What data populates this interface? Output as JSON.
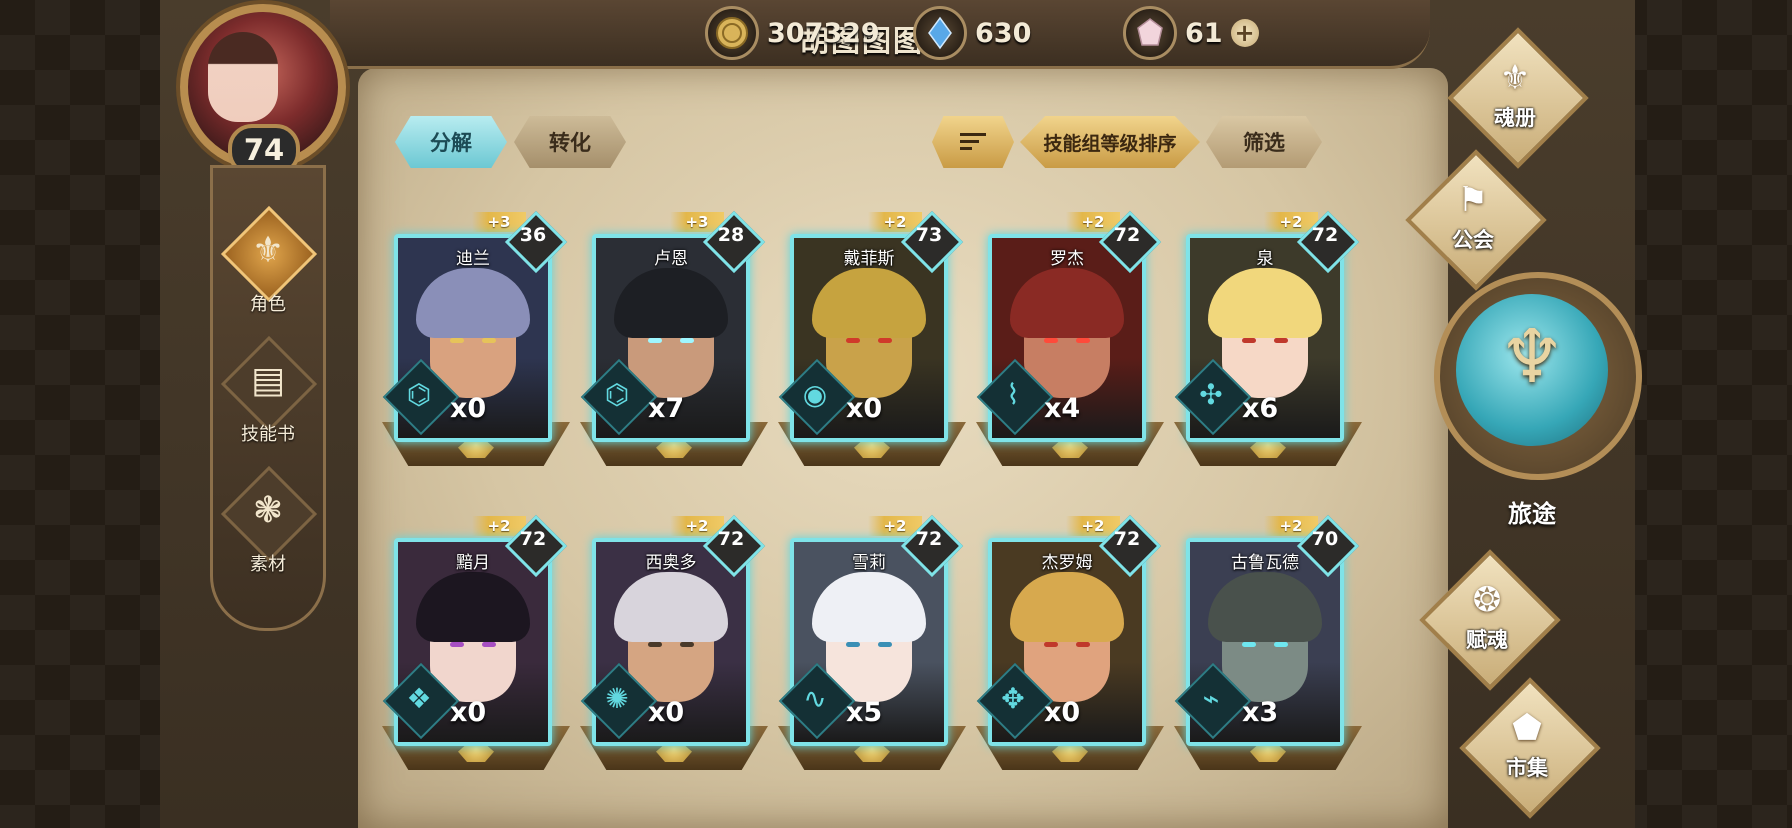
{
  "player": {
    "name": "胡图图图",
    "level": "74"
  },
  "currencies": [
    {
      "icon": "gold-coin-icon",
      "value": "307329"
    },
    {
      "icon": "blue-crystal-icon",
      "value": "630"
    },
    {
      "icon": "pink-gem-icon",
      "value": "61"
    }
  ],
  "left_nav": [
    {
      "label": "角色",
      "icon": "helmet-icon",
      "active": true
    },
    {
      "label": "技能书",
      "icon": "skill-book-icon",
      "active": false
    },
    {
      "label": "素材",
      "icon": "beast-material-icon",
      "active": false
    }
  ],
  "tabs": {
    "decompose": "分解",
    "convert": "转化"
  },
  "toolbar": {
    "sort_order_icon": "sort-lines-icon",
    "sort_label": "技能组等级排序",
    "filter_label": "筛选"
  },
  "heroes": [
    {
      "name": "迪兰",
      "bonus": "+3",
      "level": "36",
      "count": "x0"
    },
    {
      "name": "卢恩",
      "bonus": "+3",
      "level": "28",
      "count": "x7"
    },
    {
      "name": "戴菲斯",
      "bonus": "+2",
      "level": "73",
      "count": "x0"
    },
    {
      "name": "罗杰",
      "bonus": "+2",
      "level": "72",
      "count": "x4"
    },
    {
      "name": "泉",
      "bonus": "+2",
      "level": "72",
      "count": "x6"
    },
    {
      "name": "黯月",
      "bonus": "+2",
      "level": "72",
      "count": "x0"
    },
    {
      "name": "西奥多",
      "bonus": "+2",
      "level": "72",
      "count": "x0"
    },
    {
      "name": "雪莉",
      "bonus": "+2",
      "level": "72",
      "count": "x5"
    },
    {
      "name": "杰罗姆",
      "bonus": "+2",
      "level": "72",
      "count": "x0"
    },
    {
      "name": "古鲁瓦德",
      "bonus": "+2",
      "level": "70",
      "count": "x3"
    }
  ],
  "right_nav": {
    "soul_book": "魂册",
    "guild": "公会",
    "journey": "旅途",
    "fusion": "赋魂",
    "market": "市集"
  },
  "colors": {
    "card_glow": "#7fe3e8",
    "active_tab": "#8fdbe3",
    "gold": "#e3b74a"
  }
}
